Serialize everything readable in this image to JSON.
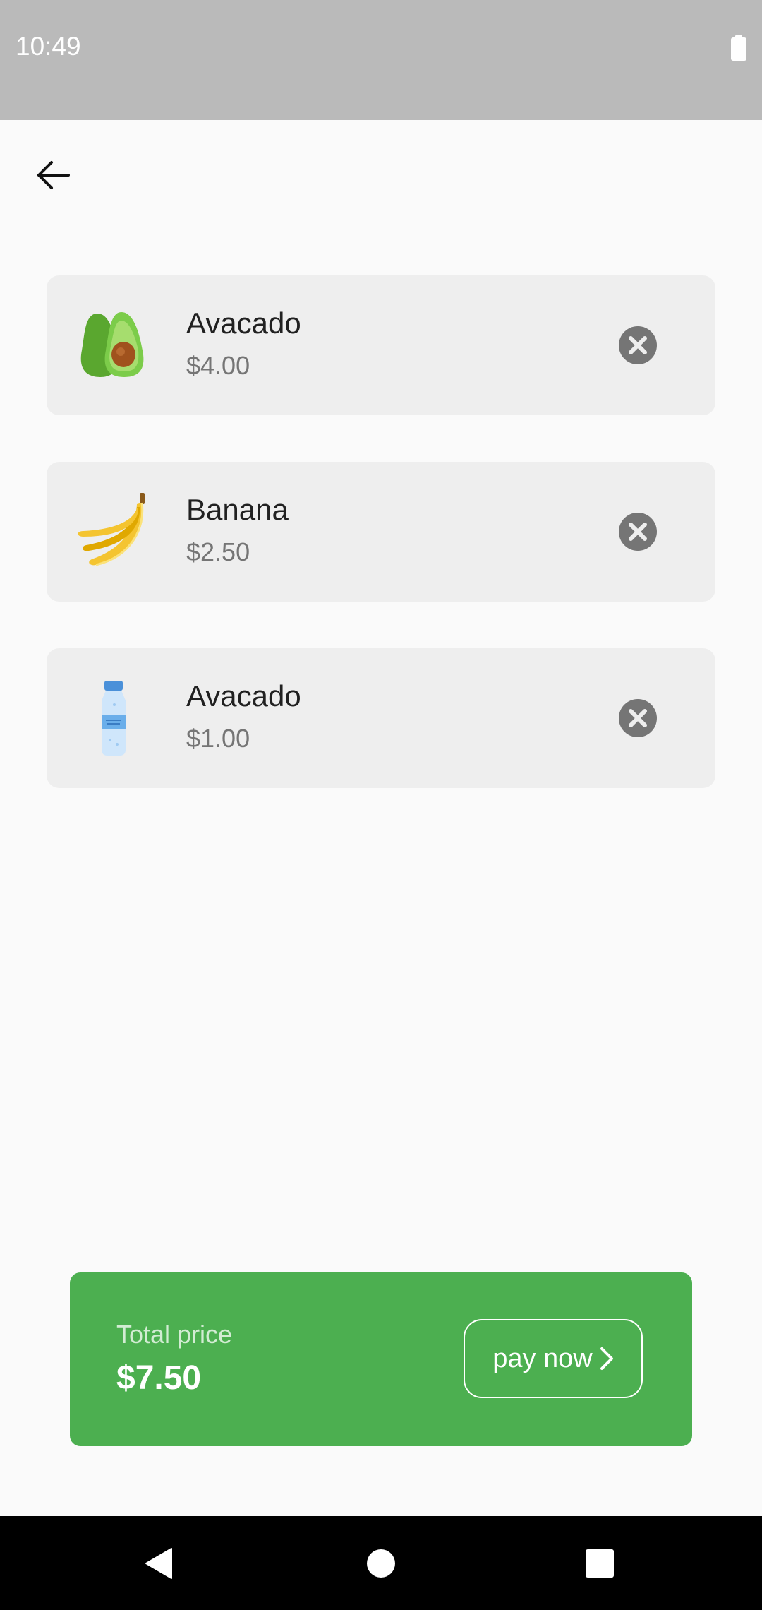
{
  "status_bar": {
    "time": "10:49",
    "battery_icon": "battery-full-icon"
  },
  "header": {
    "back_icon": "arrow-left-icon"
  },
  "cart": {
    "items": [
      {
        "name": "Avacado",
        "price": "$4.00",
        "icon": "avocado-icon"
      },
      {
        "name": "Banana",
        "price": "$2.50",
        "icon": "banana-icon"
      },
      {
        "name": "Avacado",
        "price": "$1.00",
        "icon": "water-bottle-icon"
      }
    ],
    "remove_icon": "close-circle-icon"
  },
  "total": {
    "label": "Total price",
    "value": "$7.50",
    "pay_label": "pay now",
    "accent_color": "#4caf50"
  },
  "nav_bar": {
    "back": "nav-back-icon",
    "home": "nav-home-icon",
    "recents": "nav-recents-icon"
  }
}
